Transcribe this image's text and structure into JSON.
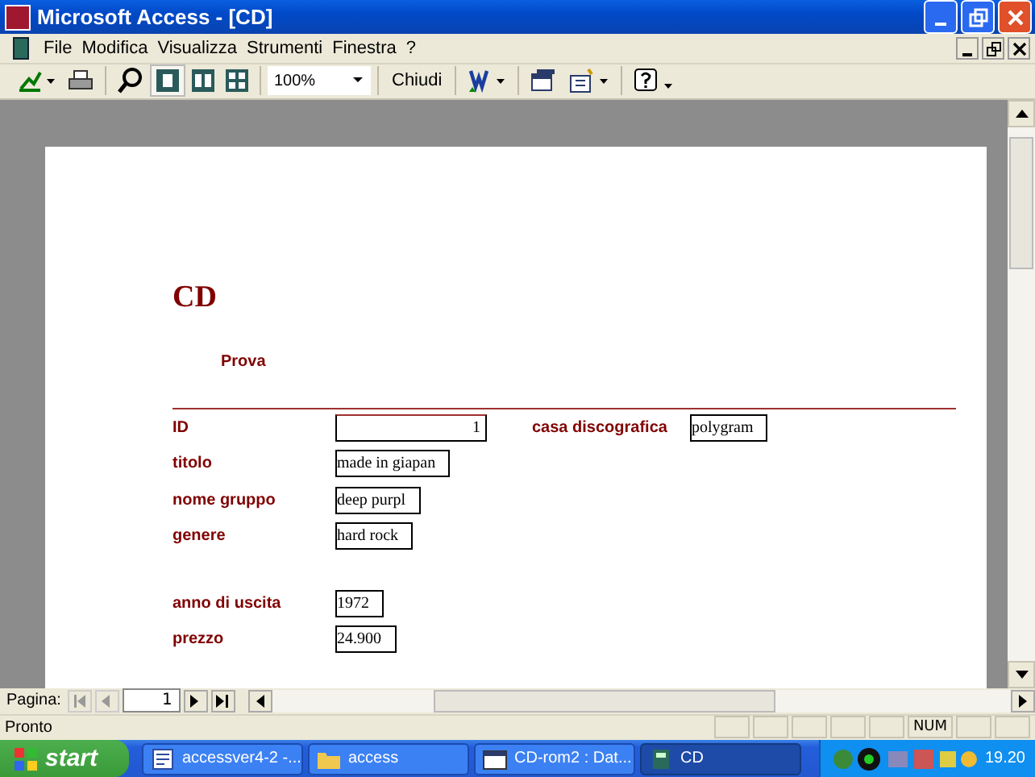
{
  "window": {
    "title": "Microsoft Access - [CD]"
  },
  "menu": [
    "File",
    "Modifica",
    "Visualizza",
    "Strumenti",
    "Finestra",
    "?"
  ],
  "toolbar": {
    "zoom": "100%",
    "close_label": "Chiudi"
  },
  "report": {
    "title": "CD",
    "subtitle": "Prova",
    "field_groups": [
      {
        "fields": [
          {
            "label": "ID",
            "value": "1",
            "kind": "number"
          },
          {
            "label": "titolo",
            "value": "made in giapan",
            "kind": "text"
          },
          {
            "label": "nome gruppo",
            "value": "deep purpl",
            "kind": "text"
          },
          {
            "label": "genere",
            "value": "hard rock",
            "kind": "text"
          }
        ]
      },
      {
        "fields": [
          {
            "label": "anno di uscita",
            "value": "1972",
            "kind": "text"
          },
          {
            "label": "prezzo",
            "value": "24.900",
            "kind": "text"
          }
        ]
      }
    ],
    "side_field": {
      "label": "casa discografica",
      "value": "polygram"
    }
  },
  "navigation": {
    "label": "Pagina:",
    "page": "1"
  },
  "status_bar": {
    "text": "Pronto",
    "indicators": [
      "NUM"
    ]
  },
  "taskbar": {
    "start": "start",
    "tasks": [
      {
        "label": "accessver4-2 -...",
        "selected": false
      },
      {
        "label": "access",
        "selected": false
      },
      {
        "label": "CD-rom2 : Dat...",
        "selected": false
      },
      {
        "label": "CD",
        "selected": true
      }
    ],
    "clock": "19.20"
  }
}
